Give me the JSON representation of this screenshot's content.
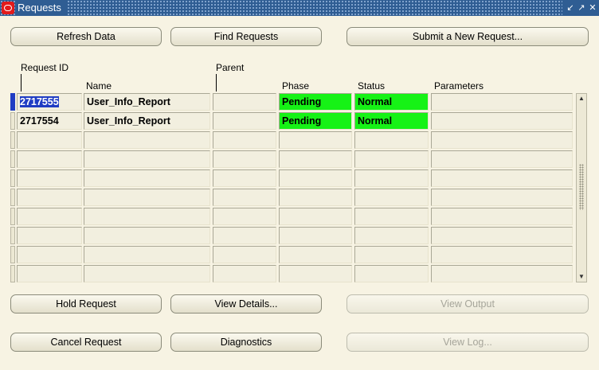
{
  "window": {
    "title": "Requests"
  },
  "buttons": {
    "refresh": "Refresh Data",
    "find": "Find Requests",
    "submit": "Submit a New Request...",
    "hold": "Hold Request",
    "view_details": "View Details...",
    "view_output": "View Output",
    "cancel": "Cancel Request",
    "diagnostics": "Diagnostics",
    "view_log": "View Log..."
  },
  "columns": {
    "request_id": "Request ID",
    "name": "Name",
    "parent": "Parent",
    "phase": "Phase",
    "status": "Status",
    "parameters": "Parameters"
  },
  "rows": [
    {
      "request_id": "2717555",
      "name": "User_Info_Report",
      "parent": "",
      "phase": "Pending",
      "status": "Normal",
      "parameters": ""
    },
    {
      "request_id": "2717554",
      "name": "User_Info_Report",
      "parent": "",
      "phase": "Pending",
      "status": "Normal",
      "parameters": ""
    },
    {
      "request_id": "",
      "name": "",
      "parent": "",
      "phase": "",
      "status": "",
      "parameters": ""
    },
    {
      "request_id": "",
      "name": "",
      "parent": "",
      "phase": "",
      "status": "",
      "parameters": ""
    },
    {
      "request_id": "",
      "name": "",
      "parent": "",
      "phase": "",
      "status": "",
      "parameters": ""
    },
    {
      "request_id": "",
      "name": "",
      "parent": "",
      "phase": "",
      "status": "",
      "parameters": ""
    },
    {
      "request_id": "",
      "name": "",
      "parent": "",
      "phase": "",
      "status": "",
      "parameters": ""
    },
    {
      "request_id": "",
      "name": "",
      "parent": "",
      "phase": "",
      "status": "",
      "parameters": ""
    },
    {
      "request_id": "",
      "name": "",
      "parent": "",
      "phase": "",
      "status": "",
      "parameters": ""
    },
    {
      "request_id": "",
      "name": "",
      "parent": "",
      "phase": "",
      "status": "",
      "parameters": ""
    }
  ],
  "colors": {
    "titlebar": "#2f5d93",
    "selection": "#1f3cc3",
    "phase_pending": "#16f216",
    "background": "#f7f3e3"
  },
  "icons": {
    "app": "oracle-logo-icon",
    "minimize": "minimize-icon",
    "restore": "restore-icon",
    "close": "close-icon"
  }
}
